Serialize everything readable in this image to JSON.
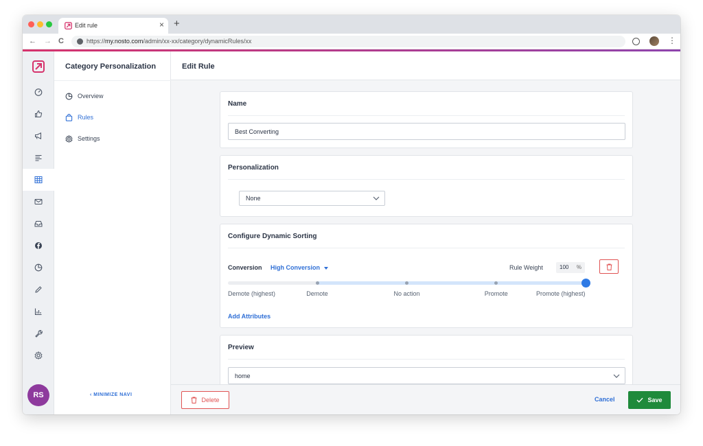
{
  "browser": {
    "tab_title": "Edit rule",
    "tab_close": "×",
    "new_tab": "+",
    "url_prefix": "https://",
    "url_host": "my.nosto.com",
    "url_path": "/admin/xx-xx/category/dynamicRules/xx",
    "nav_back": "←",
    "nav_forward": "→",
    "nav_reload": "C",
    "menu": "⋮"
  },
  "rail": {
    "icons": [
      "dashboard-icon",
      "thumbs-up-icon",
      "megaphone-icon",
      "list-icon",
      "grid-icon",
      "mail-icon",
      "inbox-icon",
      "facebook-icon",
      "pie-chart-icon",
      "pencil-icon",
      "bar-chart-icon",
      "wrench-icon",
      "gear-icon"
    ],
    "active_index": 4,
    "avatar_initials": "RS"
  },
  "subnav": {
    "title": "Category Personalization",
    "items": [
      {
        "label": "Overview",
        "icon": "pie-chart-icon"
      },
      {
        "label": "Rules",
        "icon": "bag-icon",
        "active": true
      },
      {
        "label": "Settings",
        "icon": "gear-icon"
      }
    ],
    "minimize_label": "‹ MINIMIZE NAVI"
  },
  "main": {
    "title": "Edit Rule",
    "name_card": {
      "title": "Name",
      "value": "Best Converting"
    },
    "personalization_card": {
      "title": "Personalization",
      "selected": "None"
    },
    "sorting_card": {
      "title": "Configure Dynamic Sorting",
      "conversion_label": "Conversion",
      "conversion_value": "High Conversion",
      "rule_weight_label": "Rule Weight",
      "rule_weight_value": "100",
      "rule_weight_unit": "%",
      "slider_stops": [
        "Demote (highest)",
        "Demote",
        "No action",
        "Promote",
        "Promote (highest)"
      ],
      "slider_selected_index": 4,
      "add_attributes_label": "Add Attributes"
    },
    "preview_card": {
      "title": "Preview",
      "selected": "home"
    }
  },
  "footer": {
    "delete_label": "Delete",
    "cancel_label": "Cancel",
    "save_label": "Save"
  },
  "colors": {
    "accent_blue": "#2f6fd6",
    "danger_red": "#e05252",
    "save_green": "#1f8a3b",
    "brand_pink": "#d6336c"
  }
}
